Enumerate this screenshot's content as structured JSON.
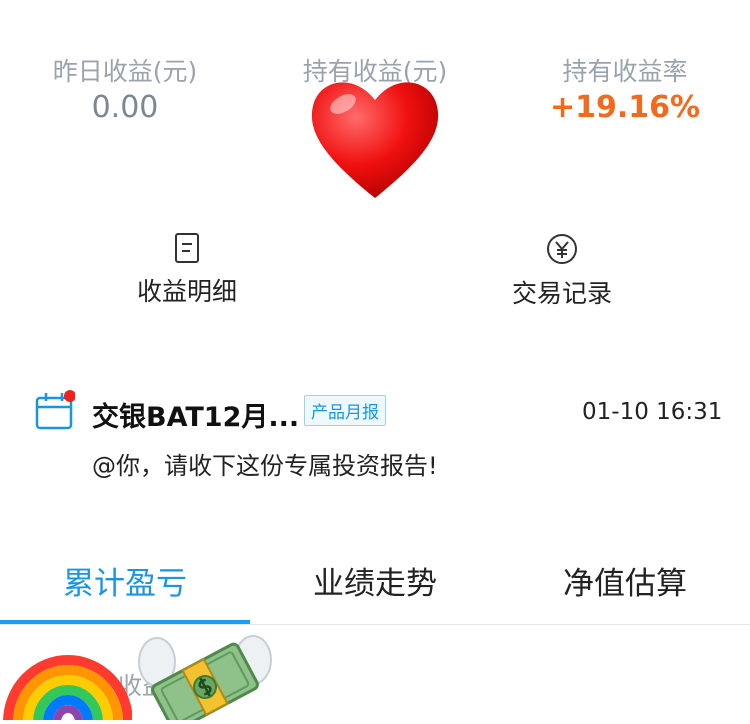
{
  "stats": [
    {
      "label": "昨日收益(元)",
      "value": "0.00"
    },
    {
      "label": "持有收益(元)",
      "value": ""
    },
    {
      "label": "持有收益率",
      "value": "+19.16%"
    }
  ],
  "actions": [
    {
      "label": "收益明细",
      "icon": "document-icon"
    },
    {
      "label": "交易记录",
      "icon": "yen-circle-icon"
    }
  ],
  "message": {
    "title": "交银BAT12月...",
    "tag": "产品月报",
    "time": "01-10 16:31",
    "body": "@你，请收下这份专属投资报告!"
  },
  "tabs": [
    {
      "label": "累计盈亏",
      "active": true
    },
    {
      "label": "业绩走势",
      "active": false
    },
    {
      "label": "净值估算",
      "active": false
    }
  ],
  "bottom": {
    "label": "收益"
  },
  "stickers": [
    "red-heart",
    "rainbow",
    "money-with-wings"
  ],
  "colors": {
    "accent": "#1a96e0",
    "orange": "#f26a1b",
    "muted": "#9aa3ad"
  }
}
